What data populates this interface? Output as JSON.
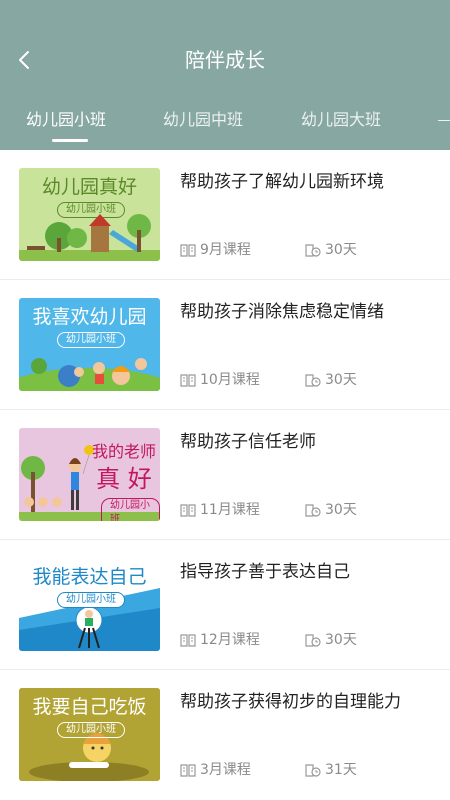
{
  "header": {
    "title": "陪伴成长"
  },
  "tabs": [
    {
      "label": "幼儿园小班"
    },
    {
      "label": "幼儿园中班"
    },
    {
      "label": "幼儿园大班"
    }
  ],
  "courses": [
    {
      "thumb_title": "幼儿园真好",
      "thumb_badge": "幼儿园小班",
      "title": "帮助孩子了解幼儿园新环境",
      "course": "9月课程",
      "days": "30天"
    },
    {
      "thumb_title": "我喜欢幼儿园",
      "thumb_badge": "幼儿园小班",
      "title": "帮助孩子消除焦虑稳定情绪",
      "course": "10月课程",
      "days": "30天"
    },
    {
      "thumb_title": "我的老师",
      "thumb_title2": "真 好",
      "thumb_badge": "幼儿园小班",
      "title": "帮助孩子信任老师",
      "course": "11月课程",
      "days": "30天"
    },
    {
      "thumb_title": "我能表达自己",
      "thumb_badge": "幼儿园小班",
      "title": "指导孩子善于表达自己",
      "course": "12月课程",
      "days": "30天"
    },
    {
      "thumb_title": "我要自己吃饭",
      "thumb_badge": "幼儿园小班",
      "title": "帮助孩子获得初步的自理能力",
      "course": "3月课程",
      "days": "31天"
    }
  ],
  "colors": {
    "header": "#87a7a3",
    "text": "#222222",
    "meta": "#8a8a8a"
  }
}
